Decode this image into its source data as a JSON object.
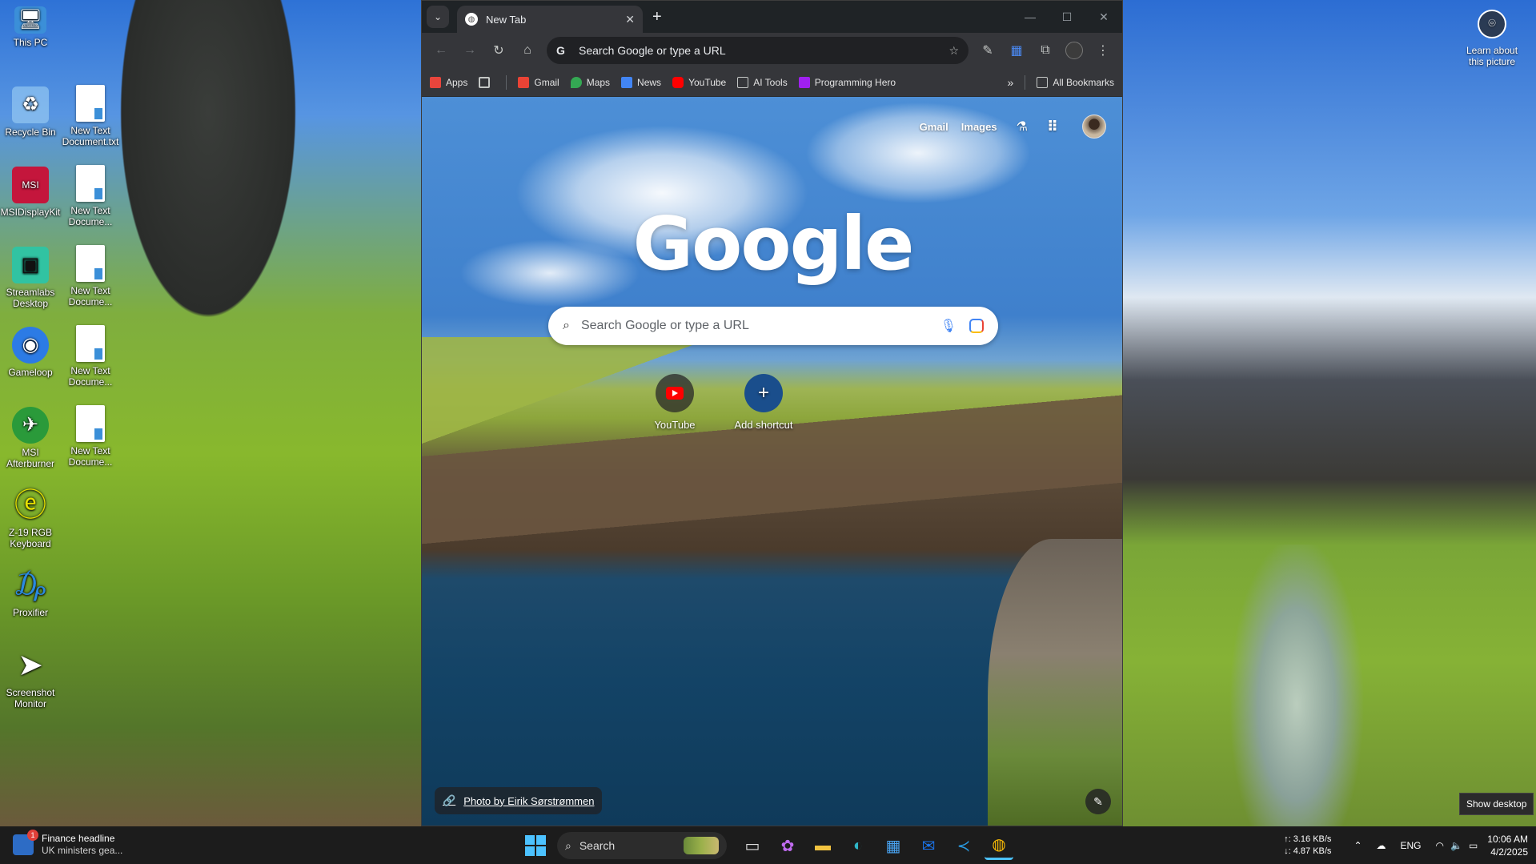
{
  "desktop": {
    "icons_left": [
      {
        "label": "This PC",
        "icon": "computer-icon",
        "color": "#3b8fd8"
      },
      {
        "label": "Recycle Bin",
        "icon": "recycle-bin-icon",
        "color": "#9fd0f5"
      },
      {
        "label": "MSIDisplayKit",
        "icon": "msi-display-icon",
        "color": "#c4163c"
      },
      {
        "label": "Streamlabs Desktop",
        "icon": "streamlabs-icon",
        "color": "#31c3a2"
      },
      {
        "label": "Gameloop",
        "icon": "gameloop-icon",
        "color": "#2c7be5"
      },
      {
        "label": "MSI Afterburner",
        "icon": "afterburner-icon",
        "color": "#2a9a3a"
      },
      {
        "label": "Z-19 RGB Keyboard",
        "icon": "keyboard-icon",
        "color": "#e6e000"
      },
      {
        "label": "Proxifier",
        "icon": "proxifier-icon",
        "color": "#2b8ae0"
      },
      {
        "label": "Screenshot Monitor",
        "icon": "screenshot-monitor-icon",
        "color": "#22b04a"
      }
    ],
    "icons_right_col": [
      {
        "label": "New Text Document.txt"
      },
      {
        "label": "New Text Docume..."
      },
      {
        "label": "New Text Docume..."
      },
      {
        "label": "New Text Docume..."
      },
      {
        "label": "New Text Docume..."
      }
    ],
    "learn_about": "Learn about this picture",
    "show_desktop": "Show desktop"
  },
  "browser": {
    "tab_title": "New Tab",
    "omnibox_text": "Search Google or type a URL",
    "bookmarks": [
      {
        "label": "Apps",
        "icon": "apps-grid-icon",
        "color": "#e8453c"
      },
      {
        "label": "",
        "icon": "tab-groups-icon",
        "color": "#c4c7c5"
      },
      {
        "label": "Gmail",
        "icon": "gmail-icon",
        "color": "#ea4335"
      },
      {
        "label": "Maps",
        "icon": "maps-icon",
        "color": "#34a853"
      },
      {
        "label": "News",
        "icon": "news-icon",
        "color": "#4285f4"
      },
      {
        "label": "YouTube",
        "icon": "youtube-icon",
        "color": "#ff0000"
      },
      {
        "label": "AI Tools",
        "icon": "folder-icon",
        "color": "#c4c7c5"
      },
      {
        "label": "Programming Hero",
        "icon": "programming-hero-icon",
        "color": "#a020f0"
      }
    ],
    "all_bookmarks": "All Bookmarks"
  },
  "ntp": {
    "top_links": {
      "gmail": "Gmail",
      "images": "Images"
    },
    "logo": "Google",
    "search_placeholder": "Search Google or type a URL",
    "shortcuts": [
      {
        "label": "YouTube"
      },
      {
        "label": "Add shortcut"
      }
    ],
    "photo_credit": "Photo by Eirik Sørstrømmen"
  },
  "taskbar": {
    "news_title": "Finance headline",
    "news_sub": "UK ministers gea...",
    "news_badge": "1",
    "search_label": "Search",
    "net_up": "↑: 3.16 KB/s",
    "net_down": "↓: 4.87 KB/s",
    "lang": "ENG",
    "time": "10:06 AM",
    "date": "4/2/2025"
  }
}
